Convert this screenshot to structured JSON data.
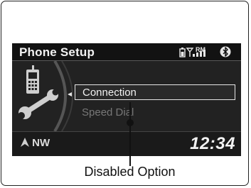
{
  "screen": {
    "header": {
      "title": "Phone Setup",
      "roaming_indicator": "RM"
    },
    "menu": [
      {
        "label": "Connection",
        "state": "selected"
      },
      {
        "label": "Speed Dial",
        "state": "disabled"
      }
    ],
    "footer": {
      "compass_direction": "NW",
      "clock": "12:34"
    }
  },
  "callout": {
    "label": "Disabled Option"
  },
  "icons": [
    "battery-icon",
    "signal-icon",
    "bluetooth-icon",
    "phone-icon",
    "wrench-icon",
    "compass-arrow-icon"
  ]
}
